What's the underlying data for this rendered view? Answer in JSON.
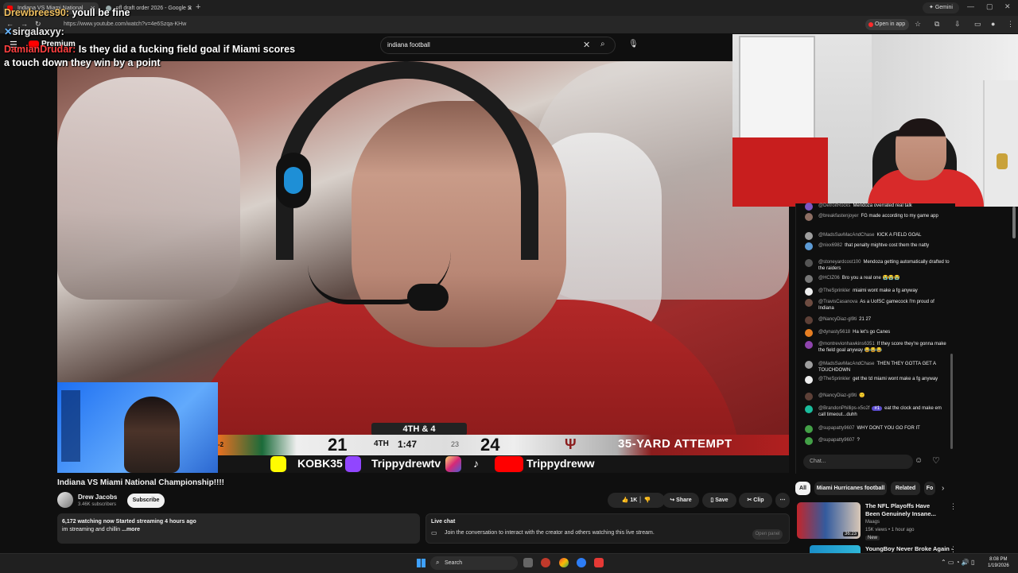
{
  "browser": {
    "tabs": [
      {
        "label": "Indiana VS Miami National"
      },
      {
        "label": "nfl draft order 2026 - Google S"
      }
    ],
    "new_tab_symbol": "+",
    "gemini_label": "Gemini",
    "url": "https://www.youtube.com/watch?v=4e6Szqa-KHw",
    "open_in_app_label": "Open in app"
  },
  "overlay_chat": [
    {
      "user": "Drewbrees90:",
      "message": "youll be fine"
    },
    {
      "user": "sirgalaxyy:",
      "message": ""
    },
    {
      "user": "DamianDrudar:",
      "message": "Is they did a fucking field goal if Miami scores"
    },
    {
      "user": "",
      "message": "a touch down they win by a point"
    }
  ],
  "youtube": {
    "logo_text": "Premium",
    "search_value": "indiana football"
  },
  "scorebug": {
    "down_distance": "4TH & 4",
    "away_record": "-2",
    "away_score": "21",
    "quarter": "4TH",
    "clock": "1:47",
    "play_clock": "23",
    "home_score": "24",
    "situation": "35-YARD ATTEMPT",
    "socials": [
      "KOBK35",
      "Trippydrewtv",
      "Trippydreww"
    ]
  },
  "video": {
    "title": "Indiana VS Miami National Championship!!!!",
    "channel_name": "Drew Jacobs",
    "subscribers": "3.46K subscribers",
    "subscribe_label": "Subscribe",
    "likes": "1K",
    "share_label": "Share",
    "save_label": "Save",
    "clip_label": "Clip",
    "watching_line": "6,172 watching now  Started streaming 4 hours ago",
    "description": "im streaming and chillin",
    "more_label": "...more"
  },
  "live_chat": {
    "title": "Live chat",
    "prompt": "Join the conversation to interact with the creator and others watching this live stream.",
    "open_panel_label": "Open panel",
    "input_placeholder": "Chat...",
    "messages": [
      {
        "user": "@DetroitRocks",
        "text": "Mendoza overrated real talk",
        "color": "#7e57c2"
      },
      {
        "user": "@breakfastenjoyer",
        "text": "FG made according to my game app",
        "color": "#8d6e63"
      },
      {
        "user": "@MadsSavMacAndChase",
        "text": "KICK A FIELD GOAL",
        "color": "#9e9e9e"
      },
      {
        "user": "@nixx6982",
        "text": "that penalty mightve cost them the natty",
        "color": "#5c9bd6"
      },
      {
        "user": "@stoneyardcost100",
        "text": "Mendoza getting automatically drafted to the raiders",
        "color": "#555555"
      },
      {
        "user": "@HCIZ06",
        "text": "Bro you a real one 😭😭😭",
        "color": "#777777"
      },
      {
        "user": "@TheSprinkler",
        "text": "miaimi wont make a fg anyway",
        "color": "#eeeeee"
      },
      {
        "user": "@TravisCasanova",
        "text": "As a UofSC gamecock I'm proud of Indiana",
        "color": "#6d4c41"
      },
      {
        "user": "@NancyDiaz-gl9ti",
        "text": "21 27",
        "color": "#5d4037"
      },
      {
        "user": "@dynasty5618",
        "text": "Ha let's go Canes",
        "color": "#e67e22"
      },
      {
        "user": "@montrevionhawkins6351",
        "text": "If they score they're gonna make the field goal anyway 😂😂😂",
        "color": "#8e44ad"
      },
      {
        "user": "@MadsSavMacAndChase",
        "text": "THEN THEY GOTTA GET A TOUCHDOWN",
        "color": "#9e9e9e"
      },
      {
        "user": "@TheSprinkler",
        "text": "get the td miami wont make a fg anyway",
        "color": "#eeeeee"
      },
      {
        "user": "@NancyDiaz-gl9ti",
        "text": "🙂",
        "color": "#5d4037"
      },
      {
        "user": "@BrandonPhillips-x5o2f",
        "badge": "#1",
        "text": "eat the clock and make em call timeout...duhh",
        "color": "#1abc9c"
      },
      {
        "user": "@supapatty9607",
        "text": "WHY DONT YOU GO FOR IT",
        "color": "#43a047"
      },
      {
        "user": "@supapatty9607",
        "text": "?",
        "color": "#43a047"
      }
    ]
  },
  "chips": [
    "All",
    "Miami Hurricanes football",
    "Related",
    "Fo"
  ],
  "related": [
    {
      "title": "The NFL Playoffs Have Been Genuinely Insane...",
      "channel": "Maags",
      "meta": "15K views • 1 hour ago",
      "badge": "New",
      "duration": "36:23"
    },
    {
      "title": "YoungBoy Never Broke Again -"
    }
  ],
  "taskbar": {
    "search_label": "Search",
    "time": "8:08 PM",
    "date": "1/19/2026"
  }
}
